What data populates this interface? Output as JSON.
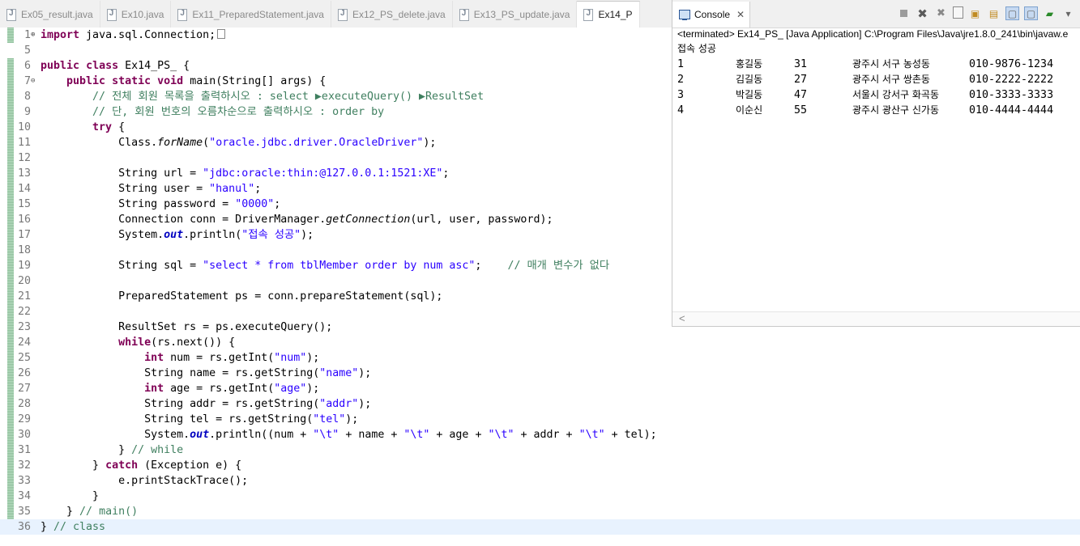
{
  "editor_tabs": [
    {
      "label": "Ex05_result.java",
      "active": false
    },
    {
      "label": "Ex10.java",
      "active": false
    },
    {
      "label": "Ex11_PreparedStatement.java",
      "active": false
    },
    {
      "label": "Ex12_PS_delete.java",
      "active": false
    },
    {
      "label": "Ex13_PS_update.java",
      "active": false
    },
    {
      "label": "Ex14_P",
      "active": true
    }
  ],
  "code": {
    "line_numbers": [
      "1",
      "5",
      "6",
      "7",
      "8",
      "9",
      "10",
      "11",
      "12",
      "13",
      "14",
      "15",
      "16",
      "17",
      "18",
      "19",
      "20",
      "21",
      "22",
      "23",
      "24",
      "25",
      "26",
      "27",
      "28",
      "29",
      "30",
      "31",
      "32",
      "33",
      "34",
      "35",
      "36"
    ],
    "import_line": [
      "import",
      " java.sql.Connection;"
    ],
    "class_decl": [
      "public",
      " ",
      "class",
      " Ex14_PS_ {"
    ],
    "main_decl": [
      "public",
      " ",
      "static",
      " ",
      "void",
      " main(String[] args) {"
    ],
    "comment1": "// 전체 회원 목록을 출력하시오 : select ▶executeQuery() ▶ResultSet",
    "comment2": "// 단, 회원 번호의 오름차순으로 출력하시오 : order by",
    "try_kw": "try",
    "try_rest": " {",
    "class_forname_pre": "Class.",
    "class_forname_method": "forName",
    "class_forname_open": "(",
    "driver_string": "\"oracle.jdbc.driver.OracleDriver\"",
    "class_forname_close": ");",
    "url_pre": "String url = ",
    "url_value": "\"jdbc:oracle:thin:@127.0.0.1:1521:XE\"",
    "user_pre": "String user = ",
    "user_value": "\"hanul\"",
    "password_pre": "String password = ",
    "password_value": "\"0000\"",
    "conn_pre": "Connection conn = DriverManager.",
    "conn_method": "getConnection",
    "conn_post": "(url, user, password);",
    "println_pre": "System.",
    "out": "out",
    "println_mid": ".println(",
    "println1_value": "\"접속 성공\"",
    "println_end": ");",
    "sql_pre": "String sql = ",
    "sql_value": "\"select * from tblMember order by num asc\"",
    "sql_post": ";",
    "sql_comment": "// 매개 변수가 없다",
    "ps_line": "PreparedStatement ps = conn.prepareStatement(sql);",
    "rs_line": "ResultSet rs = ps.executeQuery();",
    "while_kw": "while",
    "while_rest": "(rs.next()) {",
    "int_kw": "int",
    "num_pre": " num = rs.getInt(",
    "num_str": "\"num\"",
    "name_pre": "String name = rs.getString(",
    "name_str": "\"name\"",
    "age_pre": " age = rs.getInt(",
    "age_str": "\"age\"",
    "addr_pre": "String addr = rs.getString(",
    "addr_str": "\"addr\"",
    "tel_pre": "String tel = rs.getString(",
    "tel_str": "\"tel\"",
    "close_paren_semicolon": ");",
    "print2_a": "(num + ",
    "tab_str": "\"\\t\"",
    "print2_b": " + name + ",
    "print2_c": " + age + ",
    "print2_d": " + addr + ",
    "print2_e": " + tel);",
    "while_close": "} ",
    "while_comment": "// while",
    "catch_pre": "} ",
    "catch_kw": "catch",
    "catch_rest": " (Exception e) {",
    "print_stack": "e.printStackTrace();",
    "brace": "}",
    "main_close": "} ",
    "main_comment": "// main()",
    "class_close": "} ",
    "class_comment": "// class"
  },
  "console": {
    "tab_label": "Console",
    "title": "<terminated> Ex14_PS_ [Java Application] C:\\Program Files\\Java\\jre1.8.0_241\\bin\\javaw.e",
    "first_line": "접속 성공",
    "rows": [
      {
        "num": "1",
        "name": "홍길동",
        "age": "31",
        "addr": "광주시 서구 농성동",
        "tel": "010-9876-1234"
      },
      {
        "num": "2",
        "name": "김길동",
        "age": "27",
        "addr": "광주시 서구 쌍촌동",
        "tel": "010-2222-2222"
      },
      {
        "num": "3",
        "name": "박길동",
        "age": "47",
        "addr": "서울시 강서구 화곡동",
        "tel": "010-3333-3333"
      },
      {
        "num": "4",
        "name": "이순신",
        "age": "55",
        "addr": "광주시 광산구 신가동",
        "tel": "010-4444-4444"
      }
    ],
    "scroll_arrow": "<"
  }
}
